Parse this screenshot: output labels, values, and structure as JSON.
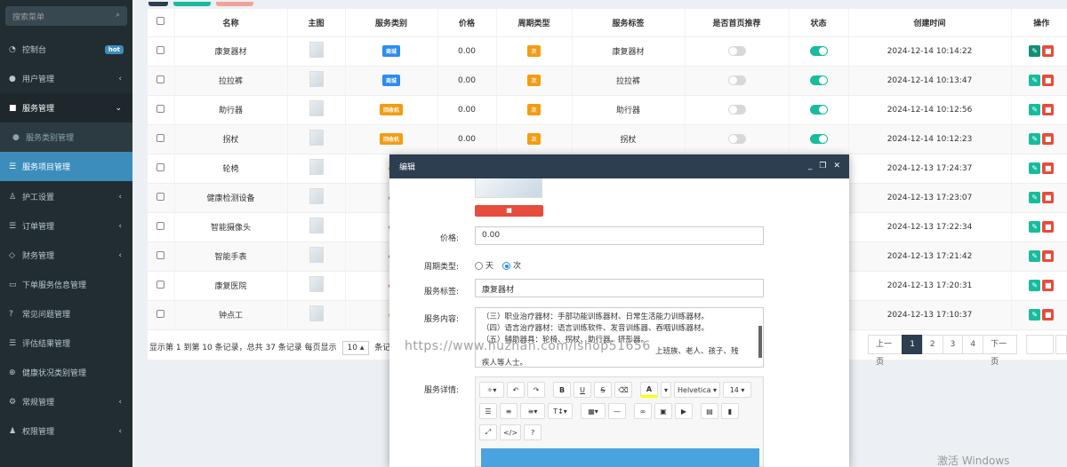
{
  "sidebar": {
    "search_placeholder": "搜索菜单",
    "items": [
      {
        "label": "控制台",
        "icon": "dashboard-icon",
        "badge": "hot"
      },
      {
        "label": "用户管理",
        "icon": "user-icon"
      },
      {
        "label": "服务管理",
        "icon": "bag-icon"
      },
      {
        "label": "服务类别管理",
        "icon": "dot-icon"
      },
      {
        "label": "服务项目管理",
        "icon": "list-icon"
      },
      {
        "label": "护工设置",
        "icon": "nurse-icon"
      },
      {
        "label": "订单管理",
        "icon": "list-icon"
      },
      {
        "label": "财务管理",
        "icon": "diamond-icon"
      },
      {
        "label": "下单服务信息管理",
        "icon": "card-icon"
      },
      {
        "label": "常见问题管理",
        "icon": "question-icon"
      },
      {
        "label": "评估结果管理",
        "icon": "list-icon"
      },
      {
        "label": "健康状况类别管理",
        "icon": "globe-icon"
      },
      {
        "label": "常规管理",
        "icon": "gears-icon"
      },
      {
        "label": "权限管理",
        "icon": "group-icon"
      }
    ]
  },
  "table": {
    "headers": [
      "名称",
      "主图",
      "服务类别",
      "价格",
      "周期类型",
      "服务标签",
      "是否首页推荐",
      "状态",
      "创建时间",
      "操作"
    ],
    "rows": [
      {
        "name": "康复器材",
        "category": "商城",
        "price": "0.00",
        "cycle": "次",
        "tag": "康复器材",
        "time": "2024-12-14 10:14:22"
      },
      {
        "name": "拉拉裤",
        "category": "商城",
        "price": "0.00",
        "cycle": "次",
        "tag": "拉拉裤",
        "time": "2024-12-14 10:13:47"
      },
      {
        "name": "助行器",
        "category": "回收机",
        "price": "0.00",
        "cycle": "次",
        "tag": "助行器",
        "time": "2024-12-14 10:12:56"
      },
      {
        "name": "拐杖",
        "category": "回收机",
        "price": "0.00",
        "cycle": "次",
        "tag": "拐杖",
        "time": "2024-12-14 10:12:23"
      },
      {
        "name": "轮椅",
        "category": "",
        "price": "",
        "cycle": "",
        "tag": "",
        "time": "2024-12-13 17:24:37"
      },
      {
        "name": "健康检测设备",
        "category": "",
        "price": "",
        "cycle": "",
        "tag": "",
        "time": "2024-12-13 17:23:07"
      },
      {
        "name": "智能摄像头",
        "category": "",
        "price": "",
        "cycle": "",
        "tag": "",
        "time": "2024-12-13 17:22:34"
      },
      {
        "name": "智能手表",
        "category": "",
        "price": "",
        "cycle": "",
        "tag": "",
        "time": "2024-12-13 17:21:42"
      },
      {
        "name": "康复医院",
        "category": "",
        "price": "",
        "cycle": "",
        "tag": "",
        "time": "2024-12-13 17:20:31"
      },
      {
        "name": "钟点工",
        "category": "",
        "price": "",
        "cycle": "",
        "tag": "",
        "time": "2024-12-13 17:10:37"
      }
    ]
  },
  "footer": {
    "info_prefix": "显示第 1 到第 10 条记录，总共 37 条记录 每页显示",
    "page_size": "10",
    "info_suffix": "条记录"
  },
  "pager": {
    "prev": "上一页",
    "pages": [
      "1",
      "2",
      "3",
      "4"
    ],
    "next": "下一页"
  },
  "modal": {
    "title": "编辑",
    "price_label": "价格:",
    "price_value": "0.00",
    "cycle_label": "周期类型:",
    "cycle_opt1": "天",
    "cycle_opt2": "次",
    "tag_label": "服务标签:",
    "tag_value": "康复器材",
    "content_label": "服务内容:",
    "content_lines": [
      "（三）职业治疗器材：手部功能训练器材、日常生活能力训练器材。",
      "（四）语言治疗器材：语言训练软件、发音训练器、吞咽训练器材。",
      "（五）辅助器具：轮椅、拐杖、助行器、挤形器。",
      "上班族、老人、孩子、残",
      "疾人等人士。"
    ],
    "detail_label": "服务详情:",
    "font_name": "Helvetica",
    "font_size": "14"
  },
  "watermark": "https://www.huzhan.com/ishop51656",
  "win_watermark": "激活 Windows"
}
